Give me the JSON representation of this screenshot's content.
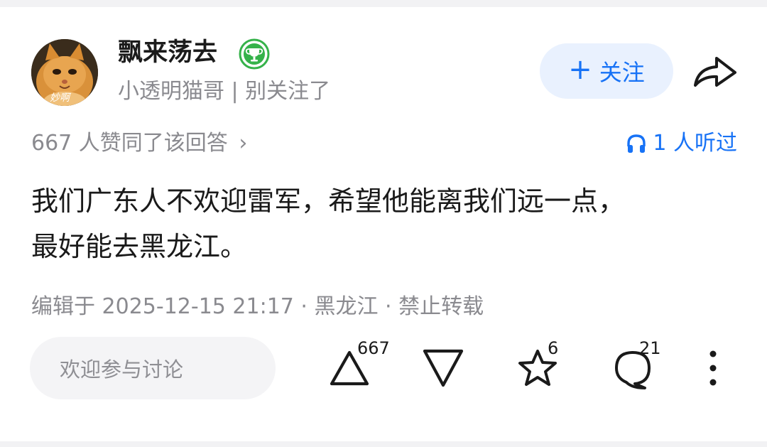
{
  "author": {
    "name": "飘来荡去",
    "bio": "小透明猫哥 | 别关注了",
    "avatar_caption": "妙啊",
    "badge_icon": "trophy-badge-icon"
  },
  "follow_button": {
    "label": "关注",
    "icon": "plus-icon"
  },
  "share_icon": "share-arrow-icon",
  "stats": {
    "votes_text": "667 人赞同了该回答",
    "votes_chevron": "›",
    "listened_text": "1 人听过",
    "listened_icon": "headphones-icon"
  },
  "answer": {
    "line1": "我们广东人不欢迎雷军，希望他能离我们远一点，",
    "line2": "最好能去黑龙江。"
  },
  "meta": "编辑于 2025-12-15 21:17 · 黑龙江 · 禁止转载",
  "comment_placeholder": "欢迎参与讨论",
  "actions": {
    "upvote_count": "667",
    "favorite_count": "6",
    "comment_count": "21"
  },
  "colors": {
    "accent": "#1772f6",
    "follow_bg": "#e9f1fe",
    "muted_text": "#8a8a8f",
    "badge_green": "#35b24a"
  }
}
